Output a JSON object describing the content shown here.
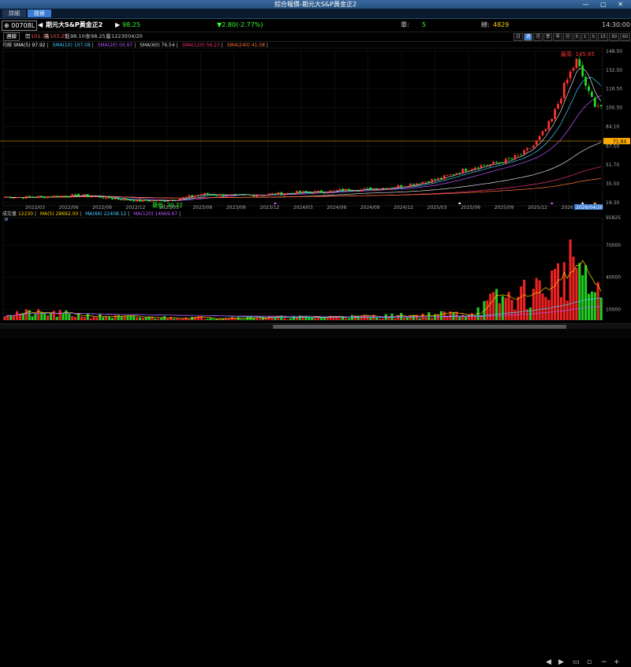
{
  "window": {
    "title": "綜合報價-期元大S&P黃金正2",
    "controls": "— ▢ ✕"
  },
  "tabs": [
    {
      "label": "詳細"
    },
    {
      "label": "技術"
    }
  ],
  "info": {
    "symbol": "00708L",
    "name": "期元大S&P黃金正2",
    "price": "98.25",
    "change": "▼2.80(-2.77%)",
    "single_label": "單:",
    "single_value": "5",
    "total_label": "總:",
    "total_value": "4829",
    "time": "14:30:00"
  },
  "quote": {
    "period": "週線",
    "open_label": "開",
    "open": "101.75",
    "high_label": "高",
    "high": "103.25",
    "low_label": "低",
    "low": "98.10",
    "close_label": "收",
    "close": "98.25",
    "vol_label": "量",
    "vol": "12230",
    "date": "04/20"
  },
  "periods": [
    "日",
    "週",
    "月",
    "季",
    "年",
    "分",
    "5",
    "1",
    "5",
    "15",
    "30",
    "60"
  ],
  "sma_legend": {
    "prefix": "均線",
    "sma5": "SMA(5) 97.92",
    "sma10": "SMA(10) 107.08",
    "sma20": "SMA(20) 00.97",
    "sma60": "SMA(60) 76.54",
    "sma120": "SMA(120) 56.23",
    "sma240": "SMA(240) 41.08"
  },
  "vol_legend": {
    "prefix": "成交量",
    "vol": "12230",
    "ma5": "MA(5) 28692.00",
    "ma66": "MA(66) 22408.12",
    "ma120": "MA(120) 14669.67"
  },
  "chart_data": [
    {
      "type": "candlestick",
      "title": "",
      "x_ticks": [
        "2022/03",
        "2022/06",
        "2022/09",
        "2022/12",
        "2023/03",
        "2023/06",
        "2023/09",
        "2023/12",
        "2024/03",
        "2024/06",
        "2024/09",
        "2024/12",
        "2025/03",
        "2025/06",
        "2025/09",
        "2025/12",
        "2026"
      ],
      "y_ticks": [
        "148.50",
        "132.50",
        "116.50",
        "100.50",
        "84.10",
        "67.50",
        "51.70",
        "35.50",
        "19.30"
      ],
      "ylim": [
        19.3,
        148.5
      ],
      "annotations": {
        "high_label": "最高: 145.65",
        "high_value": 145.65,
        "low_label": "最低: 20.22",
        "low_value": 20.22,
        "ref_line": "71.84",
        "ref_value": 71.84,
        "current_date": "2026/04/20"
      },
      "price_path": [
        [
          0,
          24
        ],
        [
          10,
          24
        ],
        [
          18,
          25
        ],
        [
          24,
          25.5
        ],
        [
          30,
          24.5
        ],
        [
          36,
          22.5
        ],
        [
          44,
          21
        ],
        [
          52,
          21
        ],
        [
          57,
          23
        ],
        [
          64,
          26.5
        ],
        [
          70,
          26
        ],
        [
          76,
          25
        ],
        [
          82,
          26
        ],
        [
          90,
          27
        ],
        [
          96,
          28
        ],
        [
          104,
          28.5
        ],
        [
          110,
          30
        ],
        [
          118,
          31
        ],
        [
          124,
          32
        ],
        [
          130,
          34
        ],
        [
          136,
          37
        ],
        [
          142,
          40
        ],
        [
          148,
          46
        ],
        [
          153,
          50
        ],
        [
          158,
          52
        ],
        [
          163,
          55
        ],
        [
          168,
          60
        ],
        [
          172,
          68
        ],
        [
          175,
          78
        ],
        [
          178,
          90
        ],
        [
          180,
          104
        ],
        [
          182,
          118
        ],
        [
          184,
          130
        ],
        [
          186,
          140
        ],
        [
          188,
          127
        ],
        [
          190,
          112
        ],
        [
          192,
          104
        ],
        [
          194,
          102
        ]
      ]
    },
    {
      "type": "bar",
      "title": "成交量",
      "y_ticks": [
        "95825",
        "70000",
        "40000",
        "10000"
      ],
      "ylim": [
        0,
        95825
      ],
      "volume_envelope": [
        [
          0,
          10000
        ],
        [
          10,
          9000
        ],
        [
          20,
          8000
        ],
        [
          30,
          5500
        ],
        [
          40,
          4000
        ],
        [
          50,
          3500
        ],
        [
          60,
          3500
        ],
        [
          70,
          3500
        ],
        [
          80,
          3500
        ],
        [
          90,
          3800
        ],
        [
          100,
          4000
        ],
        [
          110,
          4500
        ],
        [
          120,
          5000
        ],
        [
          130,
          6000
        ],
        [
          140,
          7500
        ],
        [
          150,
          9000
        ],
        [
          155,
          15000
        ],
        [
          160,
          28000
        ],
        [
          165,
          30000
        ],
        [
          170,
          35000
        ],
        [
          175,
          42000
        ],
        [
          180,
          55000
        ],
        [
          184,
          70000
        ],
        [
          186,
          95825
        ],
        [
          188,
          50000
        ],
        [
          190,
          40000
        ],
        [
          192,
          35000
        ],
        [
          194,
          30000
        ]
      ]
    }
  ]
}
